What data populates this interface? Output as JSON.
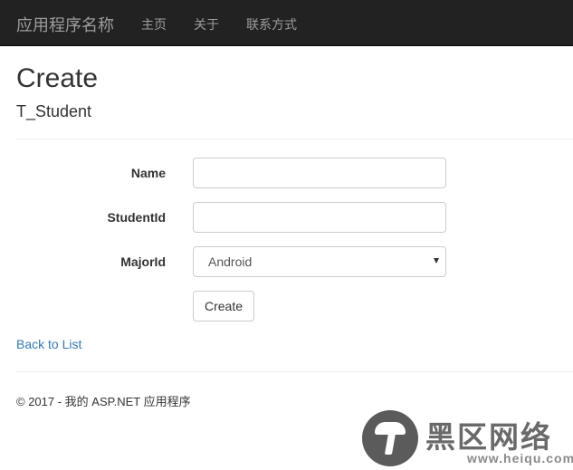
{
  "navbar": {
    "brand": "应用程序名称",
    "links": [
      {
        "label": "主页"
      },
      {
        "label": "关于"
      },
      {
        "label": "联系方式"
      }
    ]
  },
  "page": {
    "title": "Create",
    "subtitle": "T_Student"
  },
  "form": {
    "fields": [
      {
        "label": "Name",
        "value": "",
        "placeholder": ""
      },
      {
        "label": "StudentId",
        "value": "",
        "placeholder": ""
      },
      {
        "label": "MajorId",
        "selected": "Android"
      }
    ],
    "submit_label": "Create"
  },
  "back_link": "Back to List",
  "footer": "© 2017 - 我的 ASP.NET 应用程序",
  "watermark": {
    "title": "黑区网络",
    "url": "www.heiqu.com"
  },
  "colors": {
    "navbar_bg": "#222222",
    "navbar_text": "#9d9d9d",
    "link": "#337ab7",
    "text": "#333333"
  }
}
